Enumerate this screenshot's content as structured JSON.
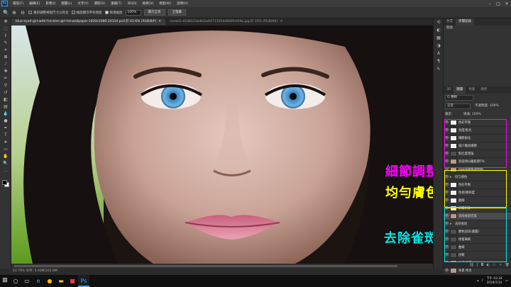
{
  "menu": [
    "檔案(F)",
    "編輯(E)",
    "影像(I)",
    "圖層(L)",
    "文字(Y)",
    "選取(S)",
    "濾鏡(T)",
    "3D(D)",
    "檢視(V)",
    "視窗(W)",
    "說明(H)"
  ],
  "options": {
    "check1": "重新調整視窗尺寸以符合",
    "check2": "縮放顯示所有視窗",
    "check3": "拖曳縮放",
    "zoom": "100%",
    "fit_screen": "顯示全頁",
    "fill_screen": "全螢幕"
  },
  "tabs": [
    {
      "label": "blue-eyed-girl-with-freckles-girl-hd-wallpaper-1920x1080-24334.psd 於 63.6% (RGB/8#)",
      "active": true
    },
    {
      "label": "model1-4108131b4b2a4f4711054d460fcd19a.jpg 於 33% (RGB/8#)",
      "active": false
    }
  ],
  "status": "63.79%   文件: 5.93M/103.9M",
  "overlays": [
    {
      "text": "細節調整",
      "color": "#ff00ff"
    },
    {
      "text": "均勻膚色",
      "color": "#ffff00"
    },
    {
      "text": "去除雀斑",
      "color": "#00e5e5"
    }
  ],
  "panel": {
    "tabs": [
      "色票",
      "步驟記錄"
    ],
    "history": [
      "開啟"
    ],
    "layer_tabs": [
      "3D",
      "圖層",
      "色版",
      "路徑"
    ],
    "search": "Q 種類",
    "blend": "正常",
    "opacity": "不透明度: 100%",
    "fill": "填滿: 100%",
    "lock": "鎖定:"
  },
  "layers": [
    {
      "name": "色彩平衡",
      "thumb": "white"
    },
    {
      "name": "亮度/對比",
      "thumb": "white"
    },
    {
      "name": "細節銳化",
      "thumb": "white"
    },
    {
      "name": "減少雜訊細節",
      "thumb": "white"
    },
    {
      "name": "對比度增強",
      "thumb": "dark"
    },
    {
      "name": "高低頻分離肌膚5%",
      "thumb": "face"
    },
    {
      "name": "Raw濾鏡肌膚修飾",
      "thumb": "face"
    },
    {
      "name": "均勻膚色",
      "thumb": "folder"
    },
    {
      "name": "色彩平衡",
      "thumb": "white"
    },
    {
      "name": "色相/飽和度",
      "thumb": "white"
    },
    {
      "name": "曲線",
      "thumb": "white"
    },
    {
      "name": "漸層對應",
      "thumb": "white"
    },
    {
      "name": "去除雀斑完成",
      "thumb": "face"
    },
    {
      "name": "去除雀斑",
      "thumb": "folder"
    },
    {
      "name": "顏色加深(圖層)",
      "thumb": "dark"
    },
    {
      "name": "修復筆刷",
      "thumb": "dark"
    },
    {
      "name": "曲線",
      "thumb": "dark"
    },
    {
      "name": "仿製",
      "thumb": "dark"
    },
    {
      "name": "曲線 亮度",
      "thumb": "face"
    },
    {
      "name": "背景 拷貝",
      "thumb": "face"
    }
  ],
  "taskbar": {
    "time": "下午 03:34",
    "date": "2019/7/31"
  }
}
